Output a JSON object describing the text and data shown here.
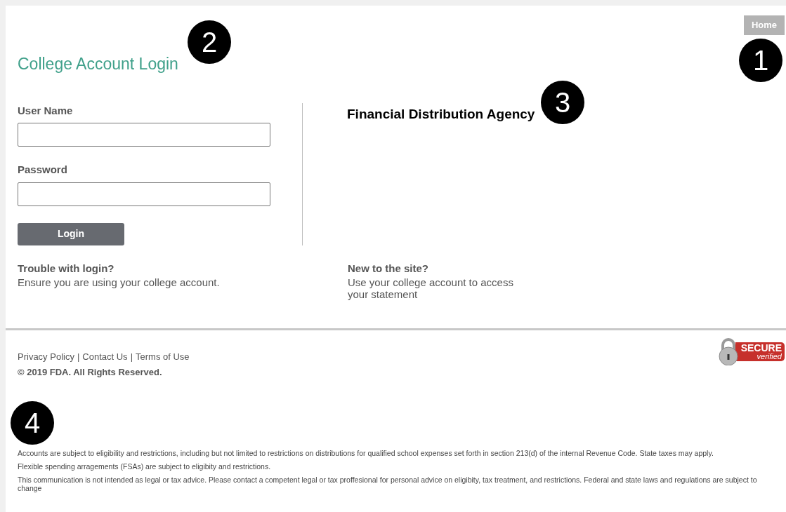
{
  "nav": {
    "home": "Home"
  },
  "title": "College Account Login",
  "form": {
    "fields": [
      {
        "label": "User Name"
      },
      {
        "label": "Password"
      }
    ],
    "button": "Login"
  },
  "agency": "Financial Distribution Agency",
  "help": [
    {
      "heading": "Trouble with login?",
      "text": "Ensure you are using your college account."
    },
    {
      "heading": "New to the site?",
      "text": "Use your college account to access your statement"
    }
  ],
  "footer": {
    "links": [
      "Privacy Policy",
      "Contact Us",
      "Terms of Use"
    ],
    "separator": "|",
    "copyright": "© 2019 FDA. All Rights Reserved.",
    "badge": {
      "main": "SECURE",
      "sub": "verified"
    }
  },
  "disclaimers": [
    "Accounts are subject to eligibility and restrictions, including but not limited to restrictions on distributions for qualified school expenses set forth in section 213(d) of the internal Revenue Code. State taxes may apply.",
    "Flexible spending arragements (FSAs) are subject to eligibity and restrictions.",
    "This communication is not intended as legal or tax advice. Please contact a competent legal or tax proffesional for personal advice on eligibity, tax treatment, and restrictions. Federal and state laws and regulations are subject to change"
  ],
  "callouts": [
    "1",
    "2",
    "3",
    "4"
  ]
}
